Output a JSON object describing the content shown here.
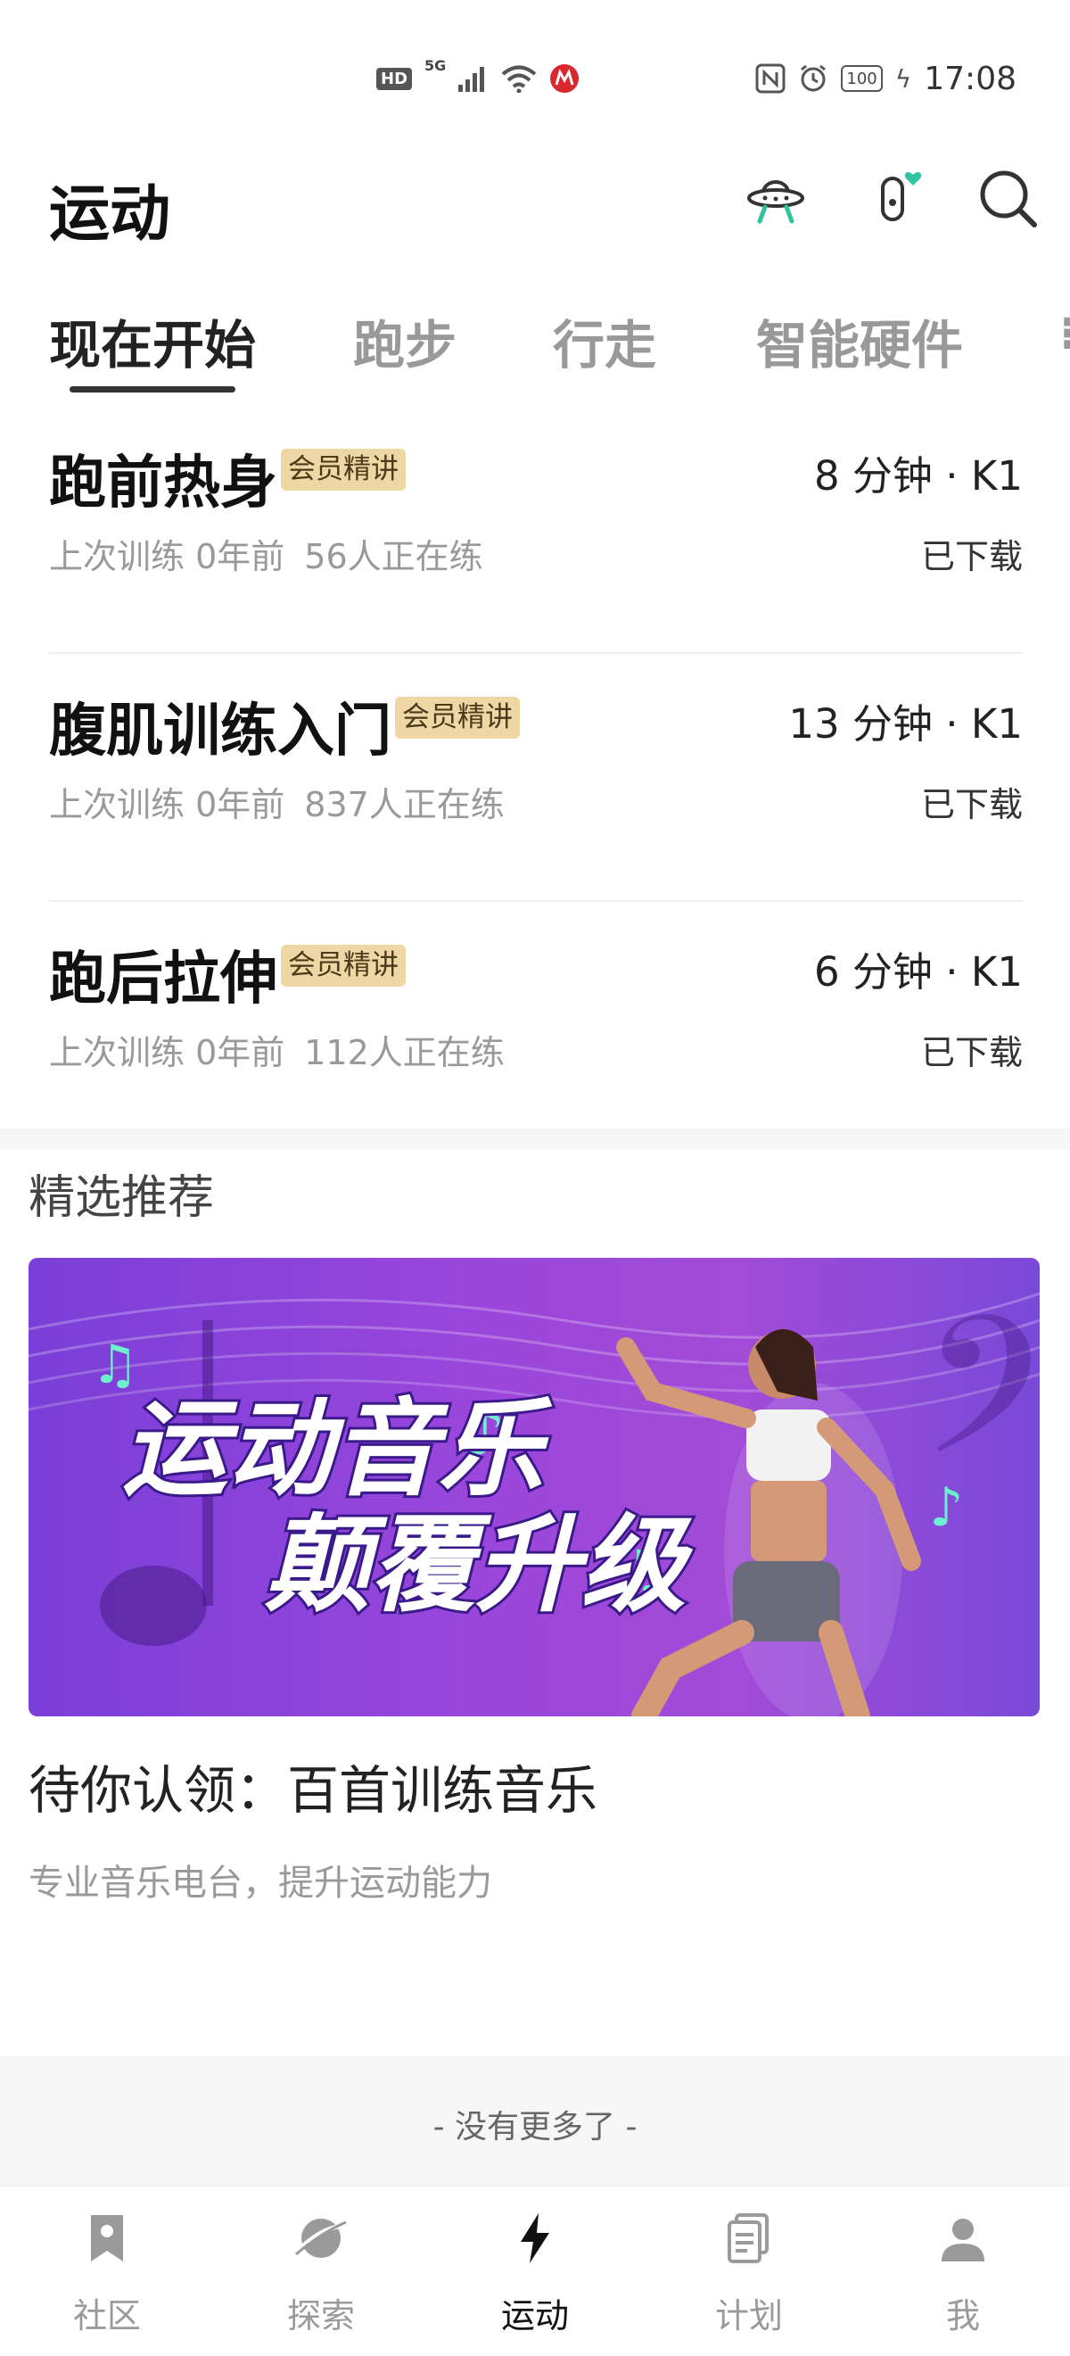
{
  "status_bar": {
    "hd": "HD",
    "net": "5G",
    "battery": "100",
    "time": "17:08"
  },
  "header": {
    "title": "运动"
  },
  "tabs": [
    {
      "label": "现在开始",
      "active": true
    },
    {
      "label": "跑步",
      "active": false
    },
    {
      "label": "行走",
      "active": false
    },
    {
      "label": "智能硬件",
      "active": false
    }
  ],
  "courses": [
    {
      "title": "跑前热身",
      "tag": "会员精讲",
      "duration": "8 分钟 · K1",
      "last_trained": "上次训练 0年前",
      "participants": "56人正在练",
      "status": "已下载"
    },
    {
      "title": "腹肌训练入门",
      "tag": "会员精讲",
      "duration": "13 分钟 · K1",
      "last_trained": "上次训练 0年前",
      "participants": "837人正在练",
      "status": "已下载"
    },
    {
      "title": "跑后拉伸",
      "tag": "会员精讲",
      "duration": "6 分钟 · K1",
      "last_trained": "上次训练 0年前",
      "participants": "112人正在练",
      "status": "已下载"
    }
  ],
  "recommend": {
    "section_title": "精选推荐",
    "banner_line1": "运动音乐",
    "banner_line2": "颠覆升级",
    "title": "待你认领：百首训练音乐",
    "subtitle": "专业音乐电台，提升运动能力"
  },
  "footer": {
    "no_more": "- 没有更多了 -"
  },
  "bottom_nav": [
    {
      "label": "社区",
      "icon": "bookmark-icon",
      "active": false
    },
    {
      "label": "探索",
      "icon": "planet-icon",
      "active": false
    },
    {
      "label": "运动",
      "icon": "lightning-icon",
      "active": true
    },
    {
      "label": "计划",
      "icon": "document-icon",
      "active": false
    },
    {
      "label": "我",
      "icon": "person-icon",
      "active": false
    }
  ],
  "colors": {
    "vip_tag_bg": "#eed7a4",
    "banner_purple": "#9b46db",
    "accent_green": "#2ec4a0"
  }
}
